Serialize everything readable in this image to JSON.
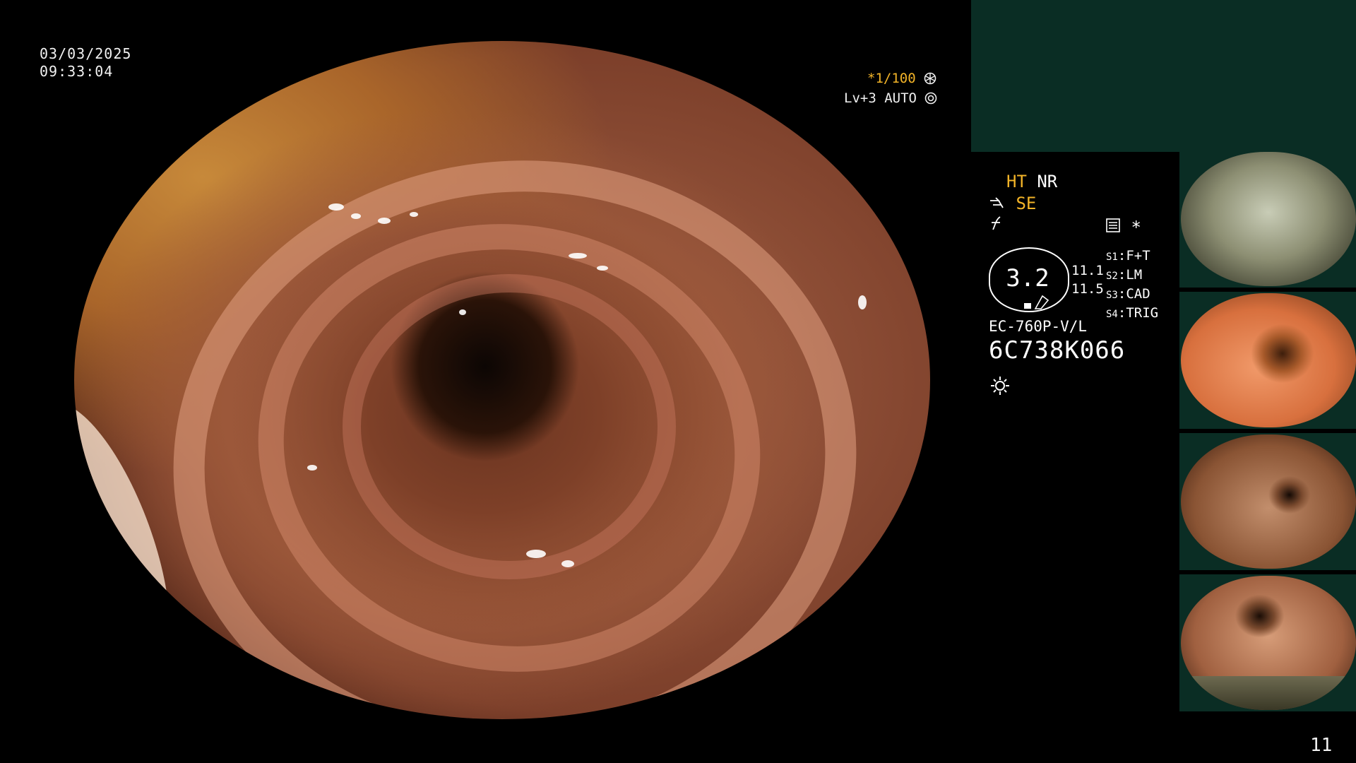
{
  "timestamp": {
    "date": "03/03/2025",
    "time": "09:33:04"
  },
  "overlay": {
    "shutter": "*1/100",
    "exposure": "Lv+3 AUTO"
  },
  "status": {
    "ht": "HT",
    "nr": "NR",
    "se": "SE",
    "asterisk": "*",
    "badge_value": "3.2",
    "value1": "11.1",
    "value2": "11.5",
    "switches": [
      {
        "key": "S1",
        "value": "F+T"
      },
      {
        "key": "S2",
        "value": "LM"
      },
      {
        "key": "S3",
        "value": "CAD"
      },
      {
        "key": "S4",
        "value": "TRIG"
      }
    ],
    "model": "EC-760P-V/L",
    "serial": "6C738K066"
  },
  "page_number": "11",
  "colors": {
    "accent_yellow": "#f3b428",
    "panel_green": "#0a2d24"
  },
  "icons": [
    "aperture-icon",
    "auto-exposure-icon",
    "scope-tip-icon",
    "f-symbol-icon",
    "record-icon",
    "brightness-icon",
    "lamp-icon"
  ]
}
